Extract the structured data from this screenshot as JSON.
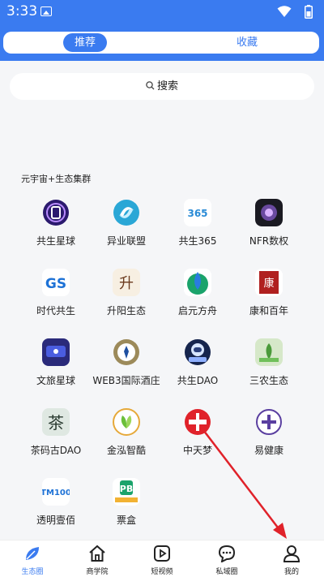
{
  "status": {
    "time": "3:33"
  },
  "tabs": {
    "recommend": "推荐",
    "favorites": "收藏"
  },
  "search": {
    "label": "搜索"
  },
  "section": {
    "title": "元宇宙+生态集群"
  },
  "apps": [
    {
      "label": "共生星球",
      "icon": "planet-icon",
      "color": "#2b1a6e"
    },
    {
      "label": "异业联盟",
      "icon": "swirl-icon",
      "color": "#2aa7d6"
    },
    {
      "label": "共生365",
      "icon": "365-icon",
      "color": "#ffffff"
    },
    {
      "label": "NFR数权",
      "icon": "nfr-icon",
      "color": "#1a1a22"
    },
    {
      "label": "时代共生",
      "icon": "gs-icon",
      "color": "#ffffff"
    },
    {
      "label": "升阳生态",
      "icon": "calligraphy-icon",
      "color": "#f7efe2"
    },
    {
      "label": "启元方舟",
      "icon": "drop-icon",
      "color": "#ffffff"
    },
    {
      "label": "康和百年",
      "icon": "seal-icon",
      "color": "#ffffff"
    },
    {
      "label": "文旅星球",
      "icon": "travel-icon",
      "color": "#2a2a7a"
    },
    {
      "label": "WEB3国际酒庄",
      "icon": "badge-icon",
      "color": "#9c8a5a"
    },
    {
      "label": "共生DAO",
      "icon": "astronaut-icon",
      "color": "#16254d"
    },
    {
      "label": "三农生态",
      "icon": "farm-icon",
      "color": "#d6e8c9"
    },
    {
      "label": "茶码古DAO",
      "icon": "tea-icon",
      "color": "#dfe8e2"
    },
    {
      "label": "金泓智酷",
      "icon": "leaf-icon",
      "color": "#ffffff"
    },
    {
      "label": "中天梦",
      "icon": "red-circle-icon",
      "color": "#e0222a"
    },
    {
      "label": "易健康",
      "icon": "health-icon",
      "color": "#ffffff"
    },
    {
      "label": "透明壹佰",
      "icon": "tm100-icon",
      "color": "#ffffff"
    },
    {
      "label": "票盒",
      "icon": "punchbox-icon",
      "color": "#ffffff"
    }
  ],
  "nav": [
    {
      "label": "生态圈",
      "icon": "leaf-nav-icon",
      "active": true
    },
    {
      "label": "商学院",
      "icon": "home-icon",
      "active": false
    },
    {
      "label": "短视频",
      "icon": "play-icon",
      "active": false
    },
    {
      "label": "私域圈",
      "icon": "chat-icon",
      "active": false
    },
    {
      "label": "我的",
      "icon": "user-icon",
      "active": false
    }
  ],
  "colors": {
    "accent": "#3a7bf0",
    "arrow": "#e0222a"
  }
}
